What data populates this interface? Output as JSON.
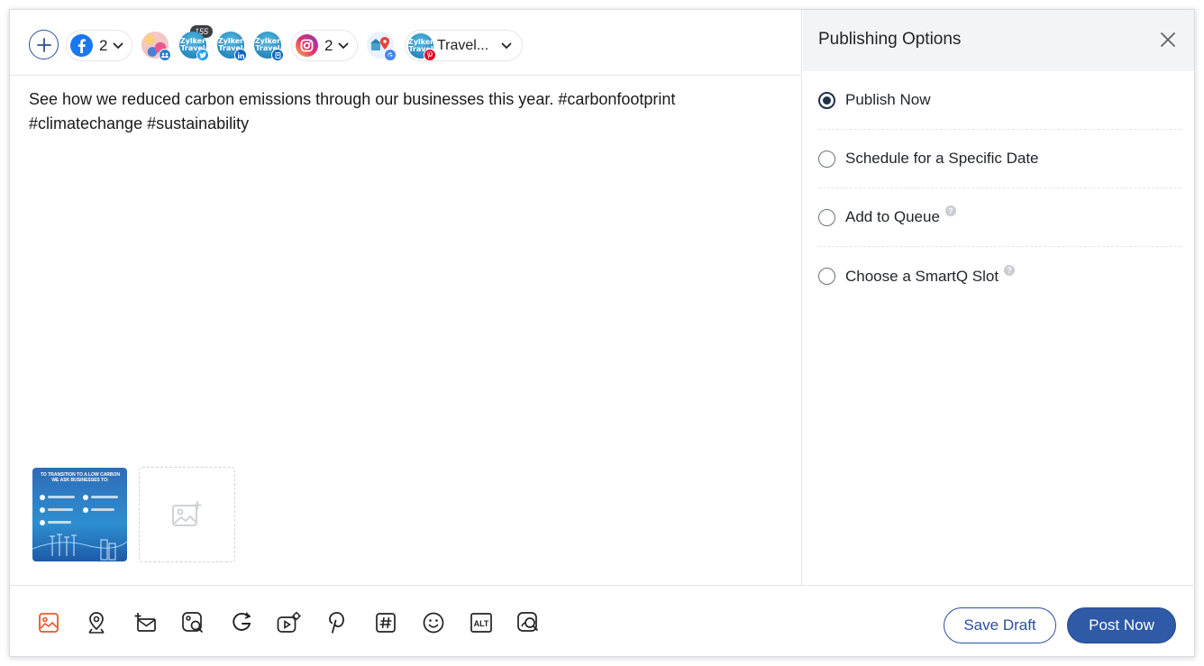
{
  "composer": {
    "accounts": {
      "facebook_count": "2",
      "twitter_char_count": "155",
      "instagram_count": "2",
      "pinterest_board": "Travel...",
      "avatar_text": [
        "Zylker",
        "Travel"
      ]
    },
    "post_text": "See how we reduced carbon emissions through our businesses this year. #carbonfootprint #climatechange #sustainability",
    "media": {
      "thumbnail_heading": "TO TRANSITION TO A LOW CARBON WE ASK BUSINESSES TO:"
    }
  },
  "panel": {
    "title": "Publishing Options",
    "options": [
      {
        "label": "Publish Now",
        "selected": true,
        "help": false
      },
      {
        "label": "Schedule for a Specific Date",
        "selected": false,
        "help": false
      },
      {
        "label": "Add to Queue",
        "selected": false,
        "help": true
      },
      {
        "label": "Choose a SmartQ Slot",
        "selected": false,
        "help": true
      }
    ],
    "help_glyph": "?"
  },
  "toolbar": {
    "tools": [
      "image-icon",
      "location-icon",
      "add-mail-icon",
      "search-image-icon",
      "google-icon",
      "video-settings-icon",
      "pinterest-icon",
      "hashtag-icon",
      "emoji-icon",
      "alt-text-icon",
      "image-search-icon"
    ],
    "alt_label": "ALT",
    "save_draft": "Save Draft",
    "post_now": "Post Now"
  },
  "colors": {
    "accent": "#2e5aa8",
    "selected_radio": "#1e2f4a",
    "facebook": "#1877f2",
    "instagram": "#d6249f",
    "pinterest": "#e60023",
    "linkedin": "#0a66c2",
    "twitter": "#1da1f2",
    "image_tool": "#e8582a"
  }
}
